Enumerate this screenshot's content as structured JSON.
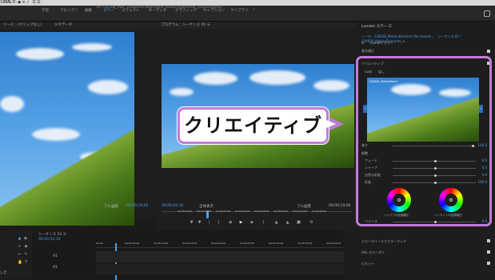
{
  "menubar": {
    "app_menu": "ヘルプ",
    "clock": "Q ☰",
    "status": "100% ▭ ◆ ≋ ♪"
  },
  "title_path": "/ホーム/Tilg_mpr_2018/Dir/Project/test_suite/Project/test_project.prproj *",
  "workspace_tabs": [
    "学習",
    "アセンブリ",
    "編集",
    "カラー",
    "エフェクト",
    "オーディオ",
    "グラフィック",
    "キャプション",
    "ライブラリ",
    "»"
  ],
  "workspace_active": "カラー",
  "source": {
    "tab": "ソース：(クリップなし)",
    "tab2": "メタデータ",
    "fit": "フル画質",
    "timecode": "00;00;10;00"
  },
  "program": {
    "tab": "プログラム：シーケンス 01 ☰",
    "timecode": "00;00;02;10",
    "fit": "全体表示",
    "quality": "フル画質",
    "duration": "00;00;10;00",
    "ruler": [
      "00;00;01;00",
      "00;00;02;00",
      "00;00;03;00",
      "00;00;04;00",
      "00;00;05;00",
      "00;00;06;00",
      "00;00;07;00",
      "00;00;08;00",
      "00;00;09;00",
      "00;00"
    ]
  },
  "timeline": {
    "tab": "シーケンス 01 ☰",
    "timecode": "00;00;02;10",
    "ruler": [
      "00;00",
      "00;00;05;00",
      "00;00;10;00",
      "00;00;15;00",
      "00;00;20;00",
      "00;00;25;00",
      "00;00;30;00",
      "00;00;35;00",
      "00;00;40;00"
    ],
    "tracks": [
      "V1",
      "A1"
    ]
  },
  "lumetri": {
    "tab": "Lumetri カラー ☰",
    "source_line": "ソース・130630_MotionElement_flw-movem...",
    "seq_line": "シーケンス 01 * 130630_MotionElements_a...",
    "fx": "fx",
    "clip_label": "Lumetri カラー",
    "basic": "基本補正",
    "creative": "クリエイティブ",
    "look_label": "Look",
    "look_value": "なし",
    "intensity_label": "強さ",
    "intensity_value": "100.0",
    "adjust": "調整",
    "sliders": [
      {
        "label": "フェード",
        "value": "0.0"
      },
      {
        "label": "シャープ",
        "value": "0.0"
      },
      {
        "label": "自然な彩度",
        "value": "0.0"
      },
      {
        "label": "彩度",
        "value": "100.0"
      }
    ],
    "wheel_left": "シャドウの色調補正",
    "wheel_right": "ハイライトの色調補正",
    "balance_label": "バランス",
    "balance_value": "0.0",
    "sections": [
      "カラーホイールとカラーマッチ",
      "HSL セカンダリ",
      "ビネット"
    ],
    "clip_name": "130630_MotionElem",
    "clip_name2": "ments_flw-movem..."
  },
  "callout": {
    "text": "クリエイティブ"
  },
  "bottom_left": {
    "label": "した"
  }
}
